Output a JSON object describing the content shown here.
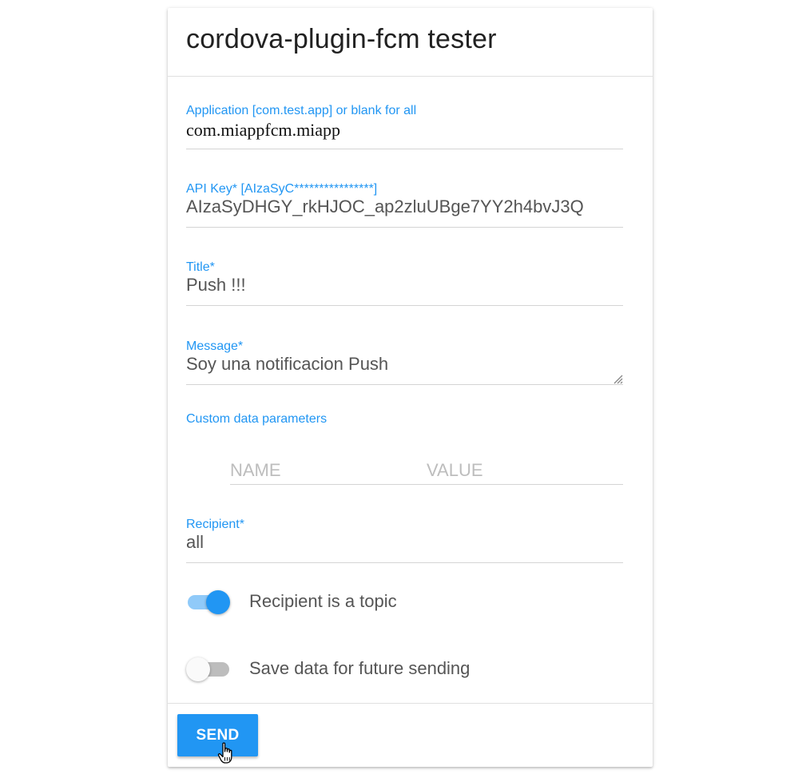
{
  "header": {
    "title": "cordova-plugin-fcm tester"
  },
  "form": {
    "application": {
      "label": "Application [com.test.app] or blank for all",
      "value": "com.miappfcm.miapp"
    },
    "api_key": {
      "label": "API Key* [AIzaSyC****************]",
      "value": "AIzaSyDHGY_rkHJOC_ap2zluUBge7YY2h4bvJ3Q"
    },
    "title": {
      "label": "Title*",
      "value": "Push !!!"
    },
    "message": {
      "label": "Message*",
      "value": "Soy una notificacion Push"
    },
    "custom_data": {
      "label": "Custom data parameters",
      "name_placeholder": "NAME",
      "value_placeholder": "VALUE"
    },
    "recipient": {
      "label": "Recipient*",
      "value": "all"
    },
    "toggles": [
      {
        "label": "Recipient is a topic",
        "checked": true
      },
      {
        "label": "Save data for future sending",
        "checked": false
      }
    ]
  },
  "footer": {
    "send_label": "SEND"
  },
  "colors": {
    "accent": "#2196f3",
    "accent_light": "#90caf9",
    "text": "#555555",
    "placeholder": "#bdbdbd",
    "divider": "#e0e0e0"
  },
  "icons": [
    "resize-handle-icon",
    "hand-pointer-icon"
  ]
}
